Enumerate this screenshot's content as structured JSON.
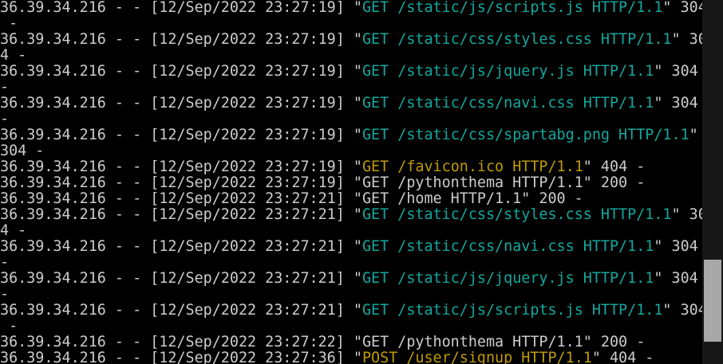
{
  "colors": {
    "background": "#000000",
    "default_text": "#cccccc",
    "request_304": "#13a89e",
    "request_404": "#c19c00",
    "scrollbar_track": "#171717",
    "scrollbar_thumb": "#a8a8a8"
  },
  "scroll_position": 0.92,
  "rows": [
    [
      {
        "t": "36.39.34.216 - - [12/Sep/2022 23:27:19] \""
      },
      {
        "t": "GET /static/js/scripts.js HTTP/1.1",
        "c": "teal"
      },
      {
        "t": "\" 304"
      }
    ],
    [
      {
        "t": " -"
      }
    ],
    [
      {
        "t": "36.39.34.216 - - [12/Sep/2022 23:27:19] \""
      },
      {
        "t": "GET /static/css/styles.css HTTP/1.1",
        "c": "teal"
      },
      {
        "t": "\" 30"
      }
    ],
    [
      {
        "t": "4 -"
      }
    ],
    [
      {
        "t": "36.39.34.216 - - [12/Sep/2022 23:27:19] \""
      },
      {
        "t": "GET /static/js/jquery.js HTTP/1.1",
        "c": "teal"
      },
      {
        "t": "\" 304"
      }
    ],
    [
      {
        "t": "-"
      }
    ],
    [
      {
        "t": "36.39.34.216 - - [12/Sep/2022 23:27:19] \""
      },
      {
        "t": "GET /static/css/navi.css HTTP/1.1",
        "c": "teal"
      },
      {
        "t": "\" 304"
      }
    ],
    [
      {
        "t": "-"
      }
    ],
    [
      {
        "t": "36.39.34.216 - - [12/Sep/2022 23:27:19] \""
      },
      {
        "t": "GET /static/css/spartabg.png HTTP/1.1",
        "c": "teal"
      },
      {
        "t": "\""
      }
    ],
    [
      {
        "t": "304 -"
      }
    ],
    [
      {
        "t": "36.39.34.216 - - [12/Sep/2022 23:27:19] \""
      },
      {
        "t": "GET /favicon.ico HTTP/1.1",
        "c": "yellow"
      },
      {
        "t": "\" 404 -"
      }
    ],
    [
      {
        "t": "36.39.34.216 - - [12/Sep/2022 23:27:19] \"GET /pythonthema HTTP/1.1\" 200 -"
      }
    ],
    [
      {
        "t": "36.39.34.216 - - [12/Sep/2022 23:27:21] \"GET /home HTTP/1.1\" 200 -"
      }
    ],
    [
      {
        "t": "36.39.34.216 - - [12/Sep/2022 23:27:21] \""
      },
      {
        "t": "GET /static/css/styles.css HTTP/1.1",
        "c": "teal"
      },
      {
        "t": "\" 30"
      }
    ],
    [
      {
        "t": "4 -"
      }
    ],
    [
      {
        "t": "36.39.34.216 - - [12/Sep/2022 23:27:21] \""
      },
      {
        "t": "GET /static/css/navi.css HTTP/1.1",
        "c": "teal"
      },
      {
        "t": "\" 304"
      }
    ],
    [
      {
        "t": "-"
      }
    ],
    [
      {
        "t": "36.39.34.216 - - [12/Sep/2022 23:27:21] \""
      },
      {
        "t": "GET /static/js/jquery.js HTTP/1.1",
        "c": "teal"
      },
      {
        "t": "\" 304"
      }
    ],
    [
      {
        "t": "-"
      }
    ],
    [
      {
        "t": "36.39.34.216 - - [12/Sep/2022 23:27:21] \""
      },
      {
        "t": "GET /static/js/scripts.js HTTP/1.1",
        "c": "teal"
      },
      {
        "t": "\" 304"
      }
    ],
    [
      {
        "t": " -"
      }
    ],
    [
      {
        "t": "36.39.34.216 - - [12/Sep/2022 23:27:22] \"GET /pythonthema HTTP/1.1\" 200 -"
      }
    ],
    [
      {
        "t": "36.39.34.216 - - [12/Sep/2022 23:27:36] \""
      },
      {
        "t": "POST /user/signup HTTP/1.1",
        "c": "yellow"
      },
      {
        "t": "\" 404 -"
      }
    ]
  ]
}
